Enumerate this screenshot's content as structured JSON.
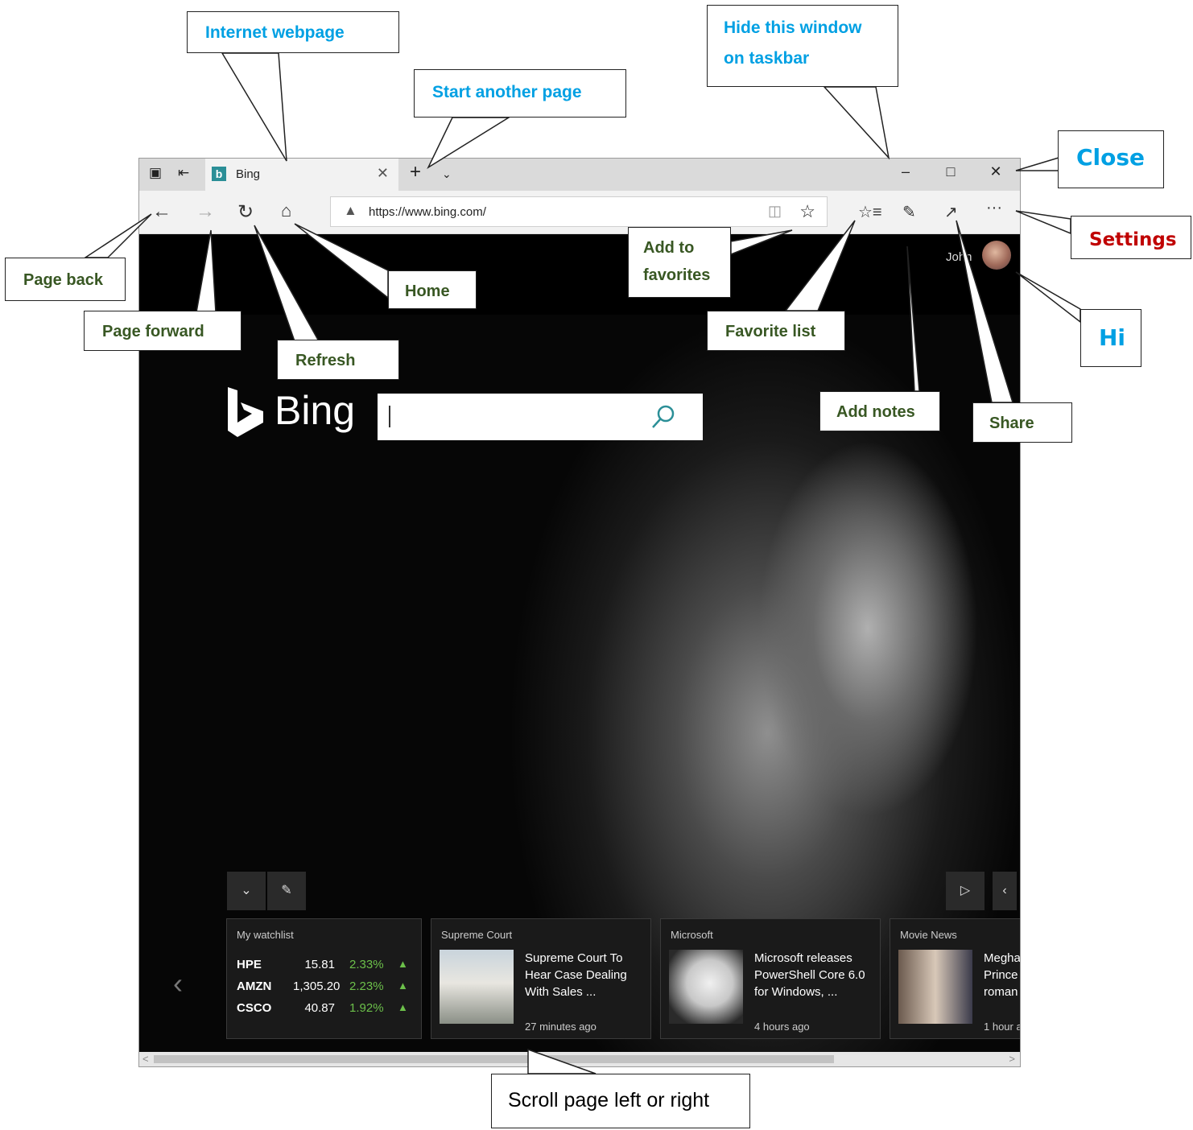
{
  "browser": {
    "tab_title": "Bing",
    "url": "https://www.bing.com/",
    "user_name": "John"
  },
  "bing": {
    "logo_text": "Bing",
    "search_value": ""
  },
  "cards": {
    "watchlist": {
      "category": "My watchlist",
      "rows": [
        {
          "symbol": "HPE",
          "price": "15.81",
          "change": "2.33%"
        },
        {
          "symbol": "AMZN",
          "price": "1,305.20",
          "change": "2.23%"
        },
        {
          "symbol": "CSCO",
          "price": "40.87",
          "change": "1.92%"
        }
      ]
    },
    "news": [
      {
        "category": "Supreme Court",
        "headline": "Supreme Court To Hear Case Dealing With Sales ...",
        "time": "27 minutes ago"
      },
      {
        "category": "Microsoft",
        "headline": "Microsoft releases PowerShell Core 6.0 for Windows, ...",
        "time": "4 hours ago"
      },
      {
        "category": "Movie News",
        "headline": "Megha Prince roman",
        "time": "1 hour a"
      }
    ]
  },
  "callouts": {
    "internet_webpage": "Internet webpage",
    "start_another_page": "Start another page",
    "hide_window_1": "Hide this window",
    "hide_window_2": "on taskbar",
    "close": "Close",
    "settings": "Settings",
    "page_back": "Page back",
    "page_forward": "Page forward",
    "refresh": "Refresh",
    "home": "Home",
    "add_to_favorites_1": "Add to",
    "add_to_favorites_2": "favorites",
    "favorite_list": "Favorite list",
    "add_notes": "Add notes",
    "share": "Share",
    "hi": "Hi",
    "scroll": "Scroll page left or right"
  },
  "colors": {
    "callout_blue": "#00a0e3",
    "callout_green": "#385723",
    "callout_red": "#c00000",
    "stock_up": "#6cc04a",
    "bing_teal": "#2b8f97"
  }
}
